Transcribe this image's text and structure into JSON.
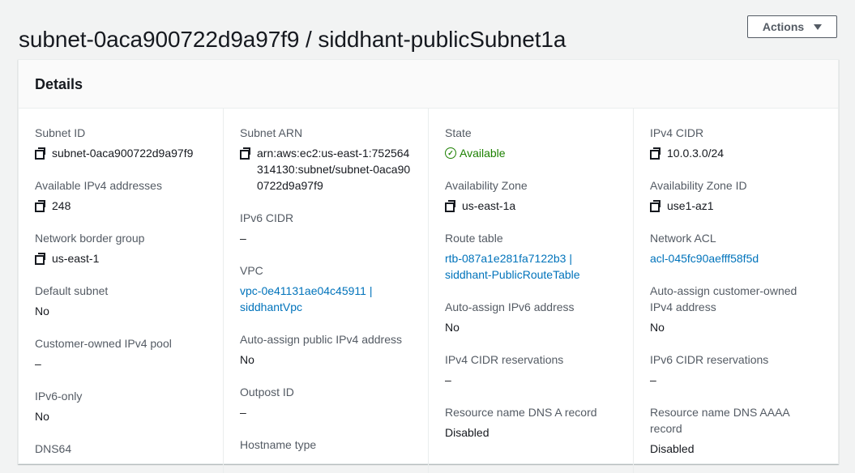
{
  "page": {
    "title": "subnet-0aca900722d9a97f9 / siddhant-publicSubnet1a",
    "actions_label": "Actions"
  },
  "details": {
    "heading": "Details",
    "col1": [
      {
        "label": "Subnet ID",
        "value": "subnet-0aca900722d9a97f9"
      },
      {
        "label": "Available IPv4 addresses",
        "value": "248"
      },
      {
        "label": "Network border group",
        "value": "us-east-1"
      },
      {
        "label": "Default subnet",
        "value": "No"
      },
      {
        "label": "Customer-owned IPv4 pool",
        "value": "–"
      },
      {
        "label": "IPv6-only",
        "value": "No"
      },
      {
        "label": "DNS64",
        "value": ""
      }
    ],
    "col2": [
      {
        "label": "Subnet ARN",
        "value": "arn:aws:ec2:us-east-1:752564314130:subnet/subnet-0aca900722d9a97f9"
      },
      {
        "label": "IPv6 CIDR",
        "value": "–"
      },
      {
        "label": "VPC",
        "value": "vpc-0e41131ae04c45911 | siddhantVpc"
      },
      {
        "label": "Auto-assign public IPv4 address",
        "value": "No"
      },
      {
        "label": "Outpost ID",
        "value": "–"
      },
      {
        "label": "Hostname type",
        "value": ""
      }
    ],
    "col3": [
      {
        "label": "State",
        "value": "Available"
      },
      {
        "label": "Availability Zone",
        "value": "us-east-1a"
      },
      {
        "label": "Route table",
        "value": "rtb-087a1e281fa7122b3 | siddhant-PublicRouteTable"
      },
      {
        "label": "Auto-assign IPv6 address",
        "value": "No"
      },
      {
        "label": "IPv4 CIDR reservations",
        "value": "–"
      },
      {
        "label": "Resource name DNS A record",
        "value": "Disabled"
      }
    ],
    "col4": [
      {
        "label": "IPv4 CIDR",
        "value": "10.0.3.0/24"
      },
      {
        "label": "Availability Zone ID",
        "value": "use1-az1"
      },
      {
        "label": "Network ACL",
        "value": "acl-045fc90aefff58f5d"
      },
      {
        "label": "Auto-assign customer-owned IPv4 address",
        "value": "No"
      },
      {
        "label": "IPv6 CIDR reservations",
        "value": "–"
      },
      {
        "label": "Resource name DNS AAAA record",
        "value": "Disabled"
      }
    ]
  },
  "colors": {
    "link": "#0073bb",
    "status_available": "#1d8102"
  },
  "icons": {
    "copy": "copy-icon",
    "status_ok": "check-circle-icon",
    "dropdown": "caret-down-icon"
  }
}
